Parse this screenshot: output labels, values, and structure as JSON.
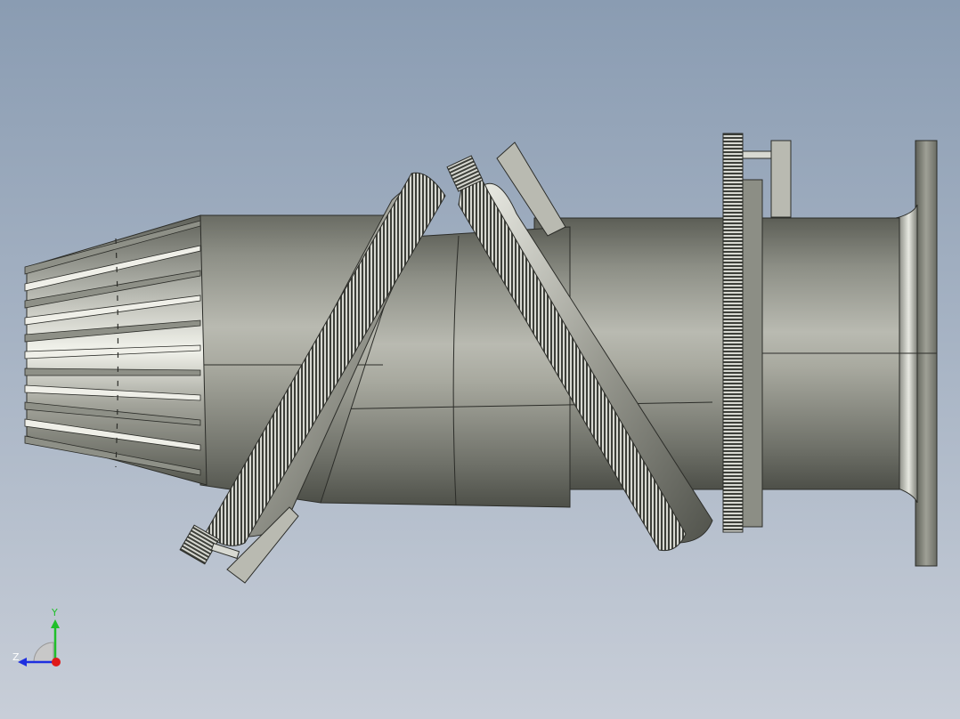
{
  "viewport": {
    "background_top": "#8a9cb2",
    "background_bottom": "#c8ced8"
  },
  "triad": {
    "y_label": "Y",
    "z_label": "Z",
    "y_color": "#1fbf2a",
    "z_color": "#1d2ee0",
    "x_color": "#e01818"
  },
  "model": {
    "icons": [
      "cad-model-icon",
      "view-triad-icon"
    ]
  }
}
